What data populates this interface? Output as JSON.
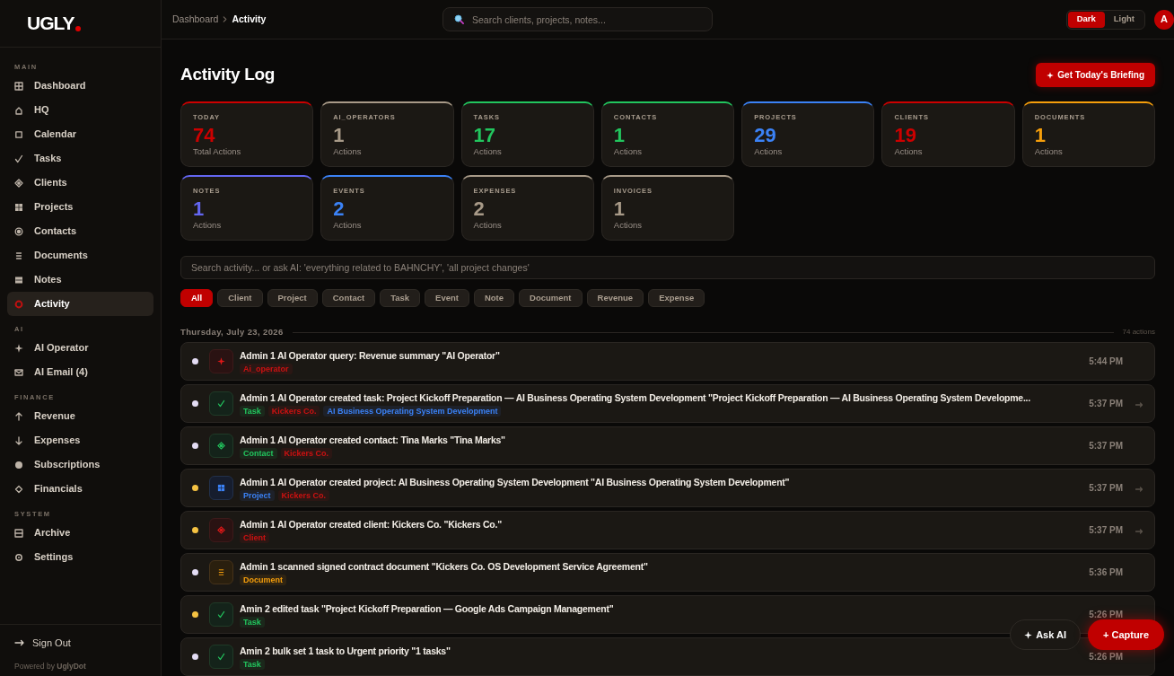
{
  "sidebar": {
    "logo": "UGLY",
    "sections": [
      {
        "title": "MAIN",
        "items": [
          {
            "label": "Dashboard",
            "selected": false
          },
          {
            "label": "HQ",
            "selected": false
          },
          {
            "label": "Calendar",
            "selected": false
          },
          {
            "label": "Tasks",
            "selected": false
          },
          {
            "label": "Clients",
            "selected": false
          },
          {
            "label": "Projects",
            "selected": false
          },
          {
            "label": "Contacts",
            "selected": false
          },
          {
            "label": "Documents",
            "selected": false
          },
          {
            "label": "Notes",
            "selected": false
          },
          {
            "label": "Activity",
            "selected": true
          }
        ]
      },
      {
        "title": "AI",
        "items": [
          {
            "label": "AI Operator",
            "selected": false
          },
          {
            "label": "AI Email (4)",
            "selected": false
          }
        ]
      },
      {
        "title": "FINANCE",
        "items": [
          {
            "label": "Revenue",
            "selected": false
          },
          {
            "label": "Expenses",
            "selected": false
          },
          {
            "label": "Subscriptions",
            "selected": false
          },
          {
            "label": "Financials",
            "selected": false
          }
        ]
      },
      {
        "title": "SYSTEM",
        "items": [
          {
            "label": "Archive",
            "selected": false
          },
          {
            "label": "Settings",
            "selected": false
          }
        ]
      }
    ],
    "sign_out": "Sign Out",
    "footer": "Powered by **UglyDot**"
  },
  "header": {
    "breadcrumb": [
      {
        "label": "Dashboard",
        "current": false
      },
      {
        "label": "Activity",
        "current": true
      }
    ],
    "search": {
      "placeholder": "Search clients, projects, notes..."
    },
    "theme_toggle": [
      {
        "label": "Dark",
        "selected": true
      },
      {
        "label": "Light",
        "selected": false
      }
    ],
    "avatar": "A"
  },
  "page": {
    "title": "Activity Log",
    "briefing_button": "Get Today's Briefing"
  },
  "stats": [
    {
      "label": "TODAY",
      "value": "74",
      "caption": "Total Actions",
      "color": "#cc0000"
    },
    {
      "label": "AI_OPERATORS",
      "value": "1",
      "caption": "Actions",
      "color": "#a89a88"
    },
    {
      "label": "TASKS",
      "value": "17",
      "caption": "Actions",
      "color": "#22c55e"
    },
    {
      "label": "CONTACTS",
      "value": "1",
      "caption": "Actions",
      "color": "#22c55e"
    },
    {
      "label": "PROJECTS",
      "value": "29",
      "caption": "Actions",
      "color": "#3b82f6"
    },
    {
      "label": "CLIENTS",
      "value": "19",
      "caption": "Actions",
      "color": "#cc0000"
    },
    {
      "label": "DOCUMENTS",
      "value": "1",
      "caption": "Actions",
      "color": "#f59e0b"
    },
    {
      "label": "NOTES",
      "value": "1",
      "caption": "Actions",
      "color": "#6366f1"
    },
    {
      "label": "EVENTS",
      "value": "2",
      "caption": "Actions",
      "color": "#3b82f6"
    },
    {
      "label": "EXPENSES",
      "value": "2",
      "caption": "Actions",
      "color": "#a89a88"
    },
    {
      "label": "INVOICES",
      "value": "1",
      "caption": "Actions",
      "color": "#a89a88"
    }
  ],
  "activity_search": {
    "placeholder": "Search activity... or ask AI: 'everything related to BAHNCHY', 'all project changes'"
  },
  "filters": [
    {
      "label": "All",
      "selected": true
    },
    {
      "label": "Client",
      "selected": false
    },
    {
      "label": "Project",
      "selected": false
    },
    {
      "label": "Contact",
      "selected": false
    },
    {
      "label": "Task",
      "selected": false
    },
    {
      "label": "Event",
      "selected": false
    },
    {
      "label": "Note",
      "selected": false
    },
    {
      "label": "Document",
      "selected": false
    },
    {
      "label": "Revenue",
      "selected": false
    },
    {
      "label": "Expense",
      "selected": false
    }
  ],
  "day_group": {
    "date": "Thursday, July 23, 2026",
    "count": "74 actions",
    "activities": [
      {
        "color": "#e4dcf4",
        "kind": "ai_operator",
        "title": "Admin 1 AI Operator query: Revenue summary \"AI Operator\"",
        "tags": [
          {
            "label": "Ai_operator",
            "color": "#cc1111"
          }
        ],
        "time": "5:44 PM",
        "linked": false
      },
      {
        "color": "#e4dcf4",
        "kind": "task",
        "title": "Admin 1 AI Operator created task: Project Kickoff Preparation — AI Business Operating System Development \"Project Kickoff Preparation — AI Business Operating System Developme...",
        "tags": [
          {
            "label": "Task",
            "color": "#22c55e"
          },
          {
            "label": "Kickers Co.",
            "color": "#cc1111"
          },
          {
            "label": "AI Business Operating System Development",
            "color": "#3b82f6"
          }
        ],
        "time": "5:37 PM",
        "linked": true
      },
      {
        "color": "#e4dcf4",
        "kind": "contact",
        "title": "Admin 1 AI Operator created contact: Tina Marks \"Tina Marks\"",
        "tags": [
          {
            "label": "Contact",
            "color": "#22c55e"
          },
          {
            "label": "Kickers Co.",
            "color": "#cc1111"
          }
        ],
        "time": "5:37 PM",
        "linked": false
      },
      {
        "color": "#f5c242",
        "kind": "project",
        "title": "Admin 1 AI Operator created project: AI Business Operating System Development \"AI Business Operating System Development\"",
        "tags": [
          {
            "label": "Project",
            "color": "#3b82f6"
          },
          {
            "label": "Kickers Co.",
            "color": "#cc1111"
          }
        ],
        "time": "5:37 PM",
        "linked": true
      },
      {
        "color": "#f5c242",
        "kind": "client",
        "title": "Admin 1 AI Operator created client: Kickers Co. \"Kickers Co.\"",
        "tags": [
          {
            "label": "Client",
            "color": "#cc1111"
          }
        ],
        "time": "5:37 PM",
        "linked": true
      },
      {
        "color": "#e4dcf4",
        "kind": "document",
        "title": "Admin 1 scanned signed contract document \"Kickers Co. OS Development Service Agreement\"",
        "tags": [
          {
            "label": "Document",
            "color": "#f59e0b"
          }
        ],
        "time": "5:36 PM",
        "linked": false
      },
      {
        "color": "#f5c242",
        "kind": "task",
        "title": "Amin 2 edited task \"Project Kickoff Preparation — Google Ads Campaign Management\"",
        "tags": [
          {
            "label": "Task",
            "color": "#22c55e"
          }
        ],
        "time": "5:26 PM",
        "linked": false
      },
      {
        "color": "#e4dcf4",
        "kind": "task",
        "title": "Amin 2 bulk set 1 task to Urgent priority \"1 tasks\"",
        "tags": [
          {
            "label": "Task",
            "color": "#22c55e"
          }
        ],
        "time": "5:26 PM",
        "linked": false
      }
    ]
  },
  "floating_buttons": {
    "ask_ai": "Ask AI",
    "capture": "+ Capture"
  }
}
